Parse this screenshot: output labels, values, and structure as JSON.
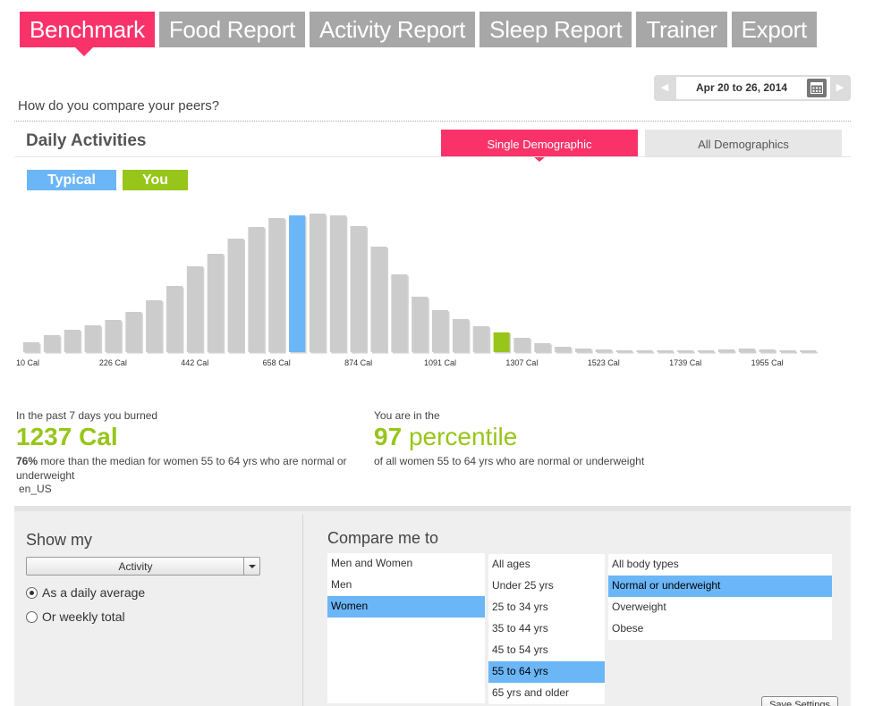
{
  "tabs": [
    {
      "label": "Benchmark",
      "active": true
    },
    {
      "label": "Food Report",
      "active": false
    },
    {
      "label": "Activity Report",
      "active": false
    },
    {
      "label": "Sleep Report",
      "active": false
    },
    {
      "label": "Trainer",
      "active": false
    },
    {
      "label": "Export",
      "active": false
    }
  ],
  "date_range": {
    "label": "Apr 20 to 26, 2014",
    "prev": "◀",
    "next": "▶"
  },
  "question": "How do you compare your peers?",
  "section_title": "Daily Activities",
  "demographic_tabs": {
    "single": "Single Demographic",
    "all": "All Demographics"
  },
  "legend": {
    "typical": "Typical",
    "you": "You"
  },
  "colors": {
    "accent": "#f9336a",
    "typical": "#6bb6f7",
    "you": "#98c519",
    "bar": "#cccccc"
  },
  "chart_data": {
    "type": "bar",
    "x_tick_labels": [
      "10 Cal",
      "226 Cal",
      "442 Cal",
      "658 Cal",
      "874 Cal",
      "1091 Cal",
      "1307 Cal",
      "1523 Cal",
      "1739 Cal",
      "1955 Cal"
    ],
    "values": [
      11,
      19,
      25,
      30,
      36,
      45,
      58,
      74,
      96,
      110,
      127,
      140,
      150,
      153,
      155,
      153,
      141,
      118,
      87,
      62,
      47,
      37,
      29,
      22,
      16,
      10,
      6,
      4,
      3,
      2,
      2,
      2,
      2,
      2,
      3,
      4,
      3,
      2,
      2
    ],
    "typical_index": 13,
    "you_index": 23,
    "ylim": [
      0,
      160
    ],
    "grid": false
  },
  "stats": {
    "burned": {
      "label": "In the past 7 days you burned",
      "value": "1237",
      "unit": "Cal",
      "desc_bold": "76%",
      "desc_rest": "more than the median for women 55 to 64 yrs who are normal or underweight",
      "locale": "en_US"
    },
    "percentile": {
      "label": "You are in the",
      "value": "97",
      "unit": "percentile",
      "desc": "of all women 55 to 64 yrs who are normal or underweight"
    }
  },
  "show_my": {
    "heading": "Show my",
    "select_value": "Activity",
    "radios": [
      {
        "label": "As a daily average",
        "checked": true
      },
      {
        "label": "Or weekly total",
        "checked": false
      }
    ]
  },
  "compare": {
    "heading": "Compare me to",
    "gender": [
      {
        "label": "Men and Women",
        "selected": false
      },
      {
        "label": "Men",
        "selected": false
      },
      {
        "label": "Women",
        "selected": true
      }
    ],
    "ages": [
      {
        "label": "All ages",
        "selected": false
      },
      {
        "label": "Under 25 yrs",
        "selected": false
      },
      {
        "label": "25 to 34 yrs",
        "selected": false
      },
      {
        "label": "35 to 44 yrs",
        "selected": false
      },
      {
        "label": "45 to 54 yrs",
        "selected": false
      },
      {
        "label": "55 to 64 yrs",
        "selected": true
      },
      {
        "label": "65 yrs and older",
        "selected": false
      }
    ],
    "body_types": [
      {
        "label": "All body types",
        "selected": false
      },
      {
        "label": "Normal or underweight",
        "selected": true
      },
      {
        "label": "Overweight",
        "selected": false
      },
      {
        "label": "Obese",
        "selected": false
      }
    ]
  },
  "save_label": "Save Settings"
}
